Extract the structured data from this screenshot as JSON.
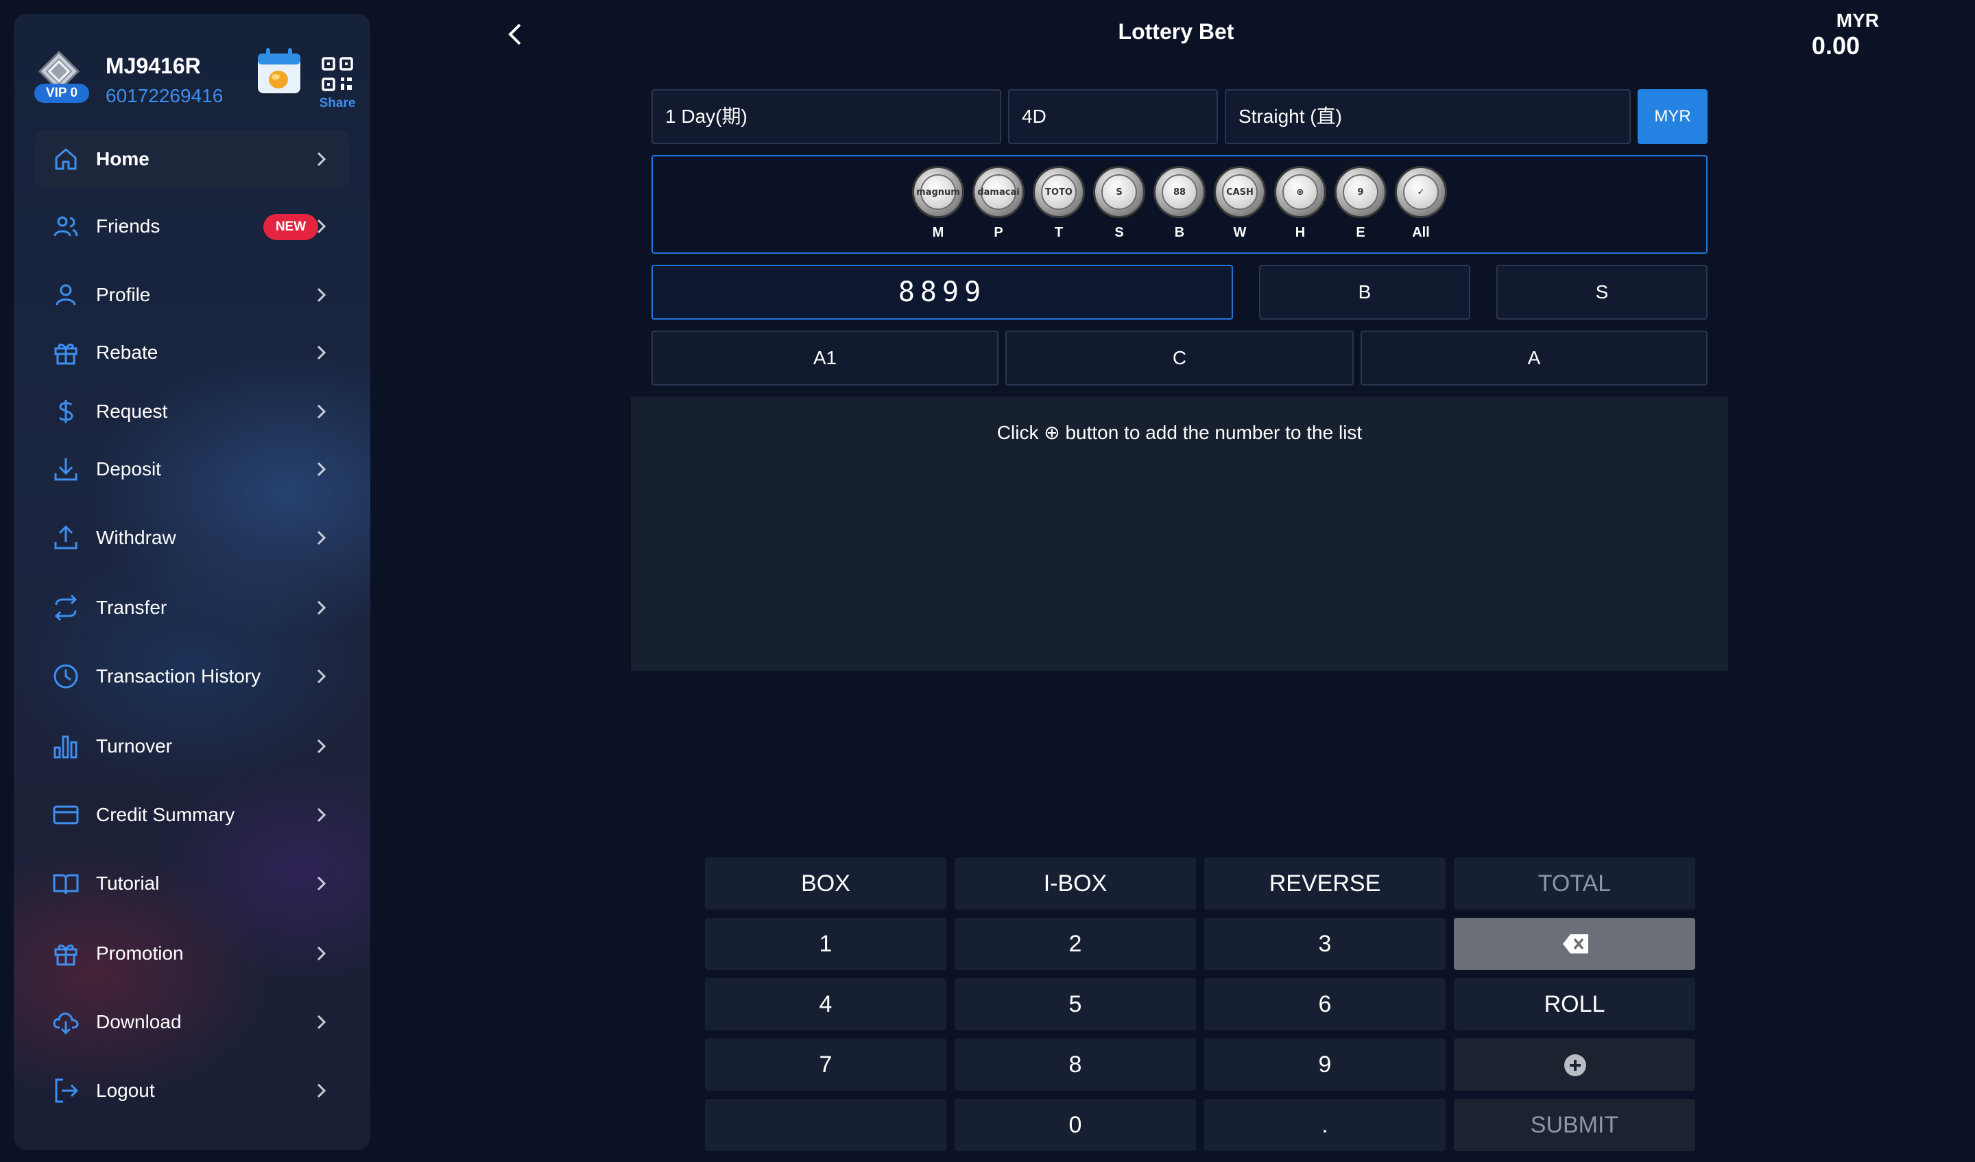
{
  "user": {
    "vip_label": "VIP 0",
    "username": "MJ9416R",
    "phone": "60172269416",
    "share_label": "Share"
  },
  "menu": [
    {
      "label": "Home",
      "icon": "home-icon",
      "active": true
    },
    {
      "label": "Friends",
      "icon": "users-icon",
      "badge": "NEW"
    },
    {
      "label": "Profile",
      "icon": "user-icon"
    },
    {
      "label": "Rebate",
      "icon": "gift-icon"
    },
    {
      "label": "Request",
      "icon": "dollar-icon"
    },
    {
      "label": "Deposit",
      "icon": "download-icon"
    },
    {
      "label": "Withdraw",
      "icon": "upload-icon"
    },
    {
      "label": "Transfer",
      "icon": "transfer-icon"
    },
    {
      "label": "Transaction History",
      "icon": "clock-icon"
    },
    {
      "label": "Turnover",
      "icon": "bar-chart-icon"
    },
    {
      "label": "Credit Summary",
      "icon": "card-icon"
    },
    {
      "label": "Tutorial",
      "icon": "book-icon"
    },
    {
      "label": "Promotion",
      "icon": "gift-icon"
    },
    {
      "label": "Download",
      "icon": "cloud-download-icon"
    },
    {
      "label": "Logout",
      "icon": "logout-icon"
    }
  ],
  "header": {
    "title": "Lottery Bet",
    "currency": "MYR",
    "balance": "0.00"
  },
  "selectors": {
    "days": "1 Day(期)",
    "game": "4D",
    "bet_type": "Straight (直)",
    "currency_button": "MYR"
  },
  "providers": [
    {
      "label": "M",
      "icon": "magnum-icon",
      "mark": "magnum"
    },
    {
      "label": "P",
      "icon": "damacai-icon",
      "mark": "damacai"
    },
    {
      "label": "T",
      "icon": "toto-icon",
      "mark": "TOTO"
    },
    {
      "label": "S",
      "icon": "singapore-pools-icon",
      "mark": "S"
    },
    {
      "label": "B",
      "icon": "88-icon",
      "mark": "88"
    },
    {
      "label": "W",
      "icon": "cash-sweep-icon",
      "mark": "CASH"
    },
    {
      "label": "H",
      "icon": "hoot-icon",
      "mark": "⊕"
    },
    {
      "label": "E",
      "icon": "lucky-icon",
      "mark": "9"
    },
    {
      "label": "All",
      "icon": "check-all-icon",
      "mark": "✓"
    }
  ],
  "bet": {
    "number": "8899",
    "b_label": "B",
    "s_label": "S",
    "a1_label": "A1",
    "c_label": "C",
    "a_label": "A"
  },
  "list_hint": "Click ⊕ button to add the number to the list",
  "keypad": {
    "box": "BOX",
    "ibox": "I-BOX",
    "reverse": "REVERSE",
    "total": "TOTAL",
    "k1": "1",
    "k2": "2",
    "k3": "3",
    "k4": "4",
    "k5": "5",
    "k6": "6",
    "k7": "7",
    "k8": "8",
    "k9": "9",
    "k0": "0",
    "dot": ".",
    "roll": "ROLL",
    "submit": "SUBMIT"
  }
}
